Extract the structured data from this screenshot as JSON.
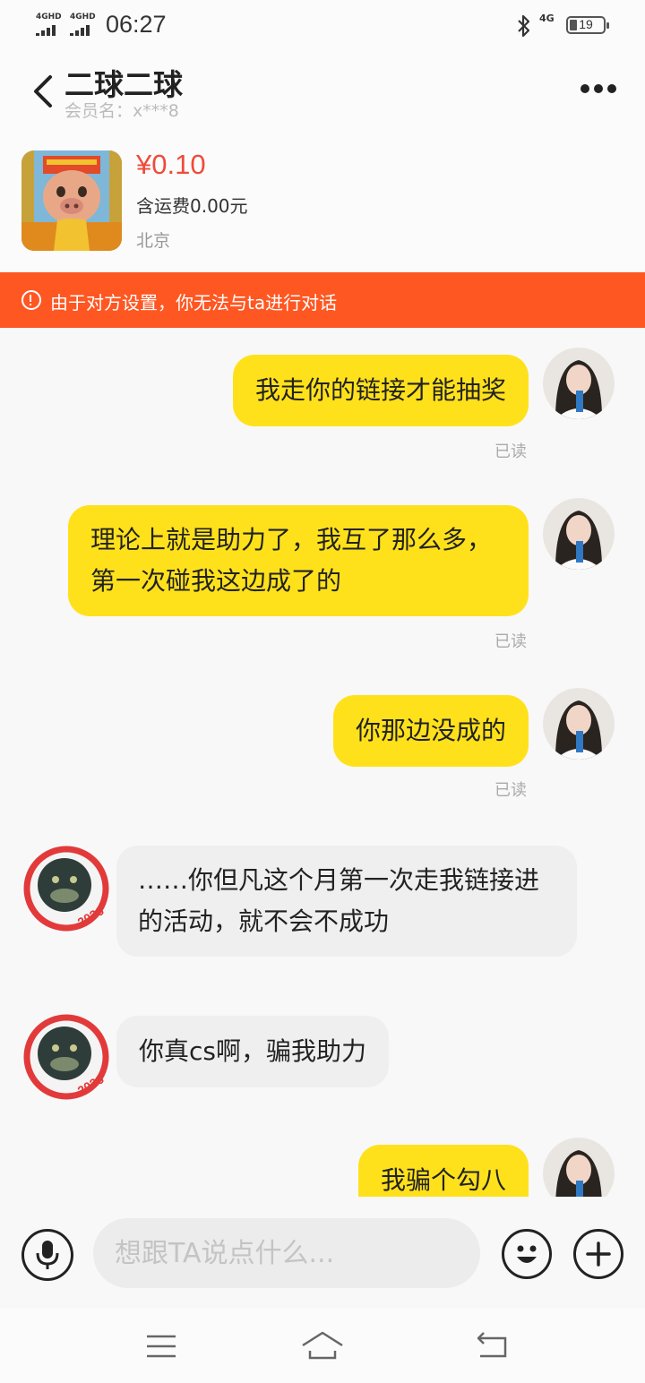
{
  "status_bar": {
    "net1": "4GHD",
    "net2": "4GHD",
    "time": "06:27",
    "net3": "4G",
    "battery": "19"
  },
  "header": {
    "title": "二球二球",
    "member": "会员名：x***8"
  },
  "product": {
    "price": "¥0.10",
    "shipping": "含运费0.00元",
    "location": "北京"
  },
  "notice": {
    "text": "由于对方设置，你无法与ta进行对话"
  },
  "messages": [
    {
      "side": "me",
      "text": "我走你的链接才能抽奖",
      "status": "已读"
    },
    {
      "side": "me",
      "text": "理论上就是助力了，我互了那么多，第一次碰我这边成了的",
      "status": "已读"
    },
    {
      "side": "me",
      "text": "你那边没成的",
      "status": "已读"
    },
    {
      "side": "them",
      "text": "……你但凡这个月第一次走我链接进的活动，就不会不成功",
      "avatar_text": "2026"
    },
    {
      "side": "them",
      "text": "你真cs啊，骗我助力",
      "avatar_text": "2026"
    },
    {
      "side": "me",
      "text": "我骗个勾八"
    }
  ],
  "input": {
    "placeholder": "想跟TA说点什么..."
  },
  "colors": {
    "my_bubble": "#ffe11b",
    "their_bubble": "#efefef",
    "notice": "#ff5722",
    "price": "#f04a3a"
  }
}
